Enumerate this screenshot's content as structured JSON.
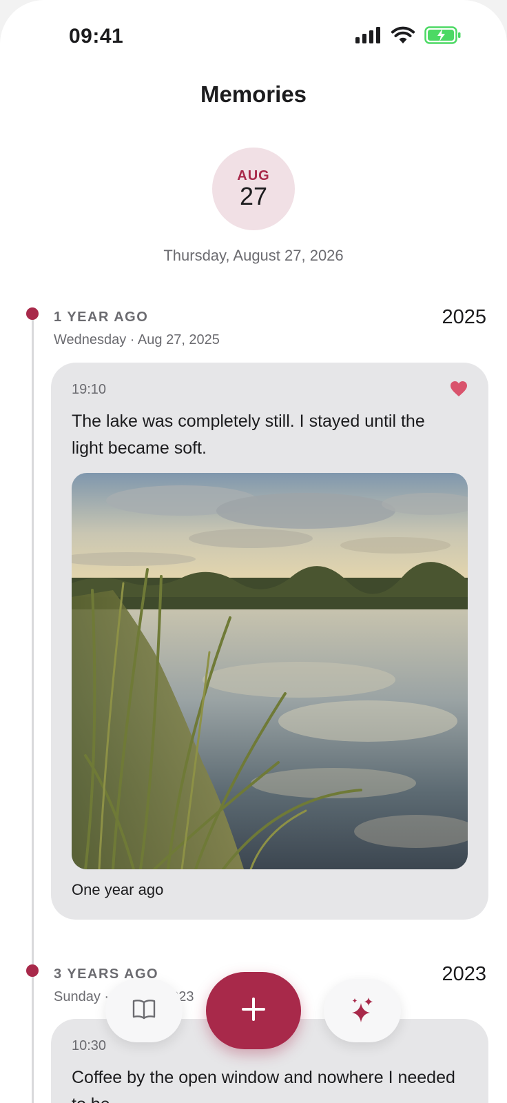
{
  "status_bar": {
    "time": "09:41"
  },
  "header": {
    "title": "Memories"
  },
  "today": {
    "month": "AUG",
    "day": "27",
    "full_date": "Thursday, August 27, 2026"
  },
  "sections": [
    {
      "ago": "1 YEAR AGO",
      "date": "Wednesday · Aug 27, 2025",
      "year": "2025",
      "entry": {
        "time": "19:10",
        "text": "The lake was completely still. I stayed until the light became soft.",
        "caption": "One year ago",
        "favorite": true
      }
    },
    {
      "ago": "3 YEARS AGO",
      "date": "Sunday · Aug 27, 2023",
      "year": "2023",
      "entry": {
        "time": "10:30",
        "text": "Coffee by the open window and nowhere I needed to be."
      }
    }
  ],
  "actions": {
    "journal_icon": "book-icon",
    "add_icon": "plus-icon",
    "ai_icon": "sparkles-icon"
  },
  "colors": {
    "accent": "#a8294a",
    "accent_soft": "#f1e0e5",
    "card": "#e6e6e8",
    "heart": "#d9546d",
    "battery": "#4cd964"
  }
}
